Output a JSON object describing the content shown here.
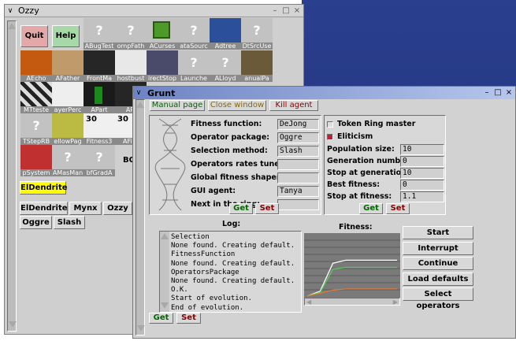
{
  "ozzy": {
    "title": "Ozzy",
    "quit_label": "Quit",
    "help_label": "Help",
    "tiles": [
      {
        "caption": "ABugTest",
        "kind": "q"
      },
      {
        "caption": "ompFath",
        "kind": "q"
      },
      {
        "caption": "ACurses",
        "kind": "cube"
      },
      {
        "caption": "ataSourc",
        "kind": "q"
      },
      {
        "caption": "Adtree",
        "kind": "photo"
      },
      {
        "caption": "DtSrcUse",
        "kind": "q"
      },
      {
        "caption": "AEcho",
        "kind": "fire"
      },
      {
        "caption": "AFather",
        "kind": "tiger"
      },
      {
        "caption": "FrontMa",
        "kind": "dark"
      },
      {
        "caption": "hostbust",
        "kind": "ghost"
      },
      {
        "caption": "irectStop",
        "kind": "photo2"
      },
      {
        "caption": "Launche",
        "kind": "q"
      },
      {
        "caption": "ALloyd",
        "kind": "q"
      },
      {
        "caption": "anualPa",
        "kind": "books"
      },
      {
        "caption": "MTteste",
        "kind": "checker"
      },
      {
        "caption": "ayerPerc",
        "kind": "paper"
      },
      {
        "caption": "APart",
        "kind": "green"
      },
      {
        "caption": "APi",
        "kind": "dark"
      },
      {
        "caption": "TStepRB",
        "kind": "q"
      },
      {
        "caption": "ellowPag",
        "kind": "yellow"
      },
      {
        "caption": "Fitness3",
        "kind": "cooking"
      },
      {
        "caption": "AFitn",
        "kind": "cooking"
      },
      {
        "caption": "pSystem",
        "kind": "abacus"
      },
      {
        "caption": "AMasMan",
        "kind": "q"
      },
      {
        "caption": "bfGradA",
        "kind": "q"
      },
      {
        "caption": "BO",
        "kind": "none"
      }
    ],
    "cooking_number": "30",
    "eldendrite_highlight": "ElDendrite",
    "buttons_row1": [
      "ElDendrite",
      "Mynx",
      "Ozzy"
    ],
    "buttons_row2": [
      "Oggre",
      "Slash"
    ],
    "highlight_color": "#ffff00"
  },
  "grunt": {
    "title": "Grunt",
    "toolbar": {
      "manual": "Manual page",
      "close": "Close window",
      "kill": "Kill agent",
      "manual_color": "#006600",
      "close_color": "#8a6a00",
      "kill_color": "#880000"
    },
    "operators": [
      {
        "label": "Fitness function:",
        "value": "DeJong"
      },
      {
        "label": "Operator package:",
        "value": "Oggre"
      },
      {
        "label": "Selection method:",
        "value": "Slash"
      },
      {
        "label": "Operators rates tuner:",
        "value": ""
      },
      {
        "label": "Global fitness shaper:",
        "value": ""
      },
      {
        "label": "GUI agent:",
        "value": "Tanya"
      },
      {
        "label": "Next in the ring:",
        "value": ""
      }
    ],
    "get_label": "Get",
    "set_label": "Set",
    "token_ring_label": "Token Ring master",
    "elitism_label": "Eliticism",
    "params": [
      {
        "label": "Population size:",
        "value": "10"
      },
      {
        "label": "Generation number:",
        "value": "0"
      },
      {
        "label": "Stop at generation:",
        "value": "10"
      },
      {
        "label": "Best fitness:",
        "value": "0"
      },
      {
        "label": "Stop at fitness:",
        "value": "1.1"
      }
    ],
    "log_title": "Log:",
    "log_lines": [
      "Selection",
      "None found. Creating default.",
      "FitnessFunction",
      "None found. Creating default.",
      "OperatorsPackage",
      "None found. Creating default.",
      "O.K.",
      "Start of evolution.",
      "End of evolution."
    ],
    "fitness_title": "Fitness:",
    "actions": [
      "Start",
      "Interrupt",
      "Continue",
      "Load defaults",
      "Select operators"
    ],
    "fitness_series": [
      {
        "color": "#ffffff",
        "values": [
          0,
          0.08,
          0.55,
          0.6,
          0.6,
          0.6,
          0.6,
          0.6
        ]
      },
      {
        "color": "#55cc55",
        "values": [
          0,
          0.06,
          0.45,
          0.48,
          0.48,
          0.48,
          0.48,
          0.48
        ]
      },
      {
        "color": "#e07a3a",
        "values": [
          0,
          0.05,
          0.1,
          0.12,
          0.12,
          0.12,
          0.12,
          0.12
        ]
      }
    ]
  }
}
